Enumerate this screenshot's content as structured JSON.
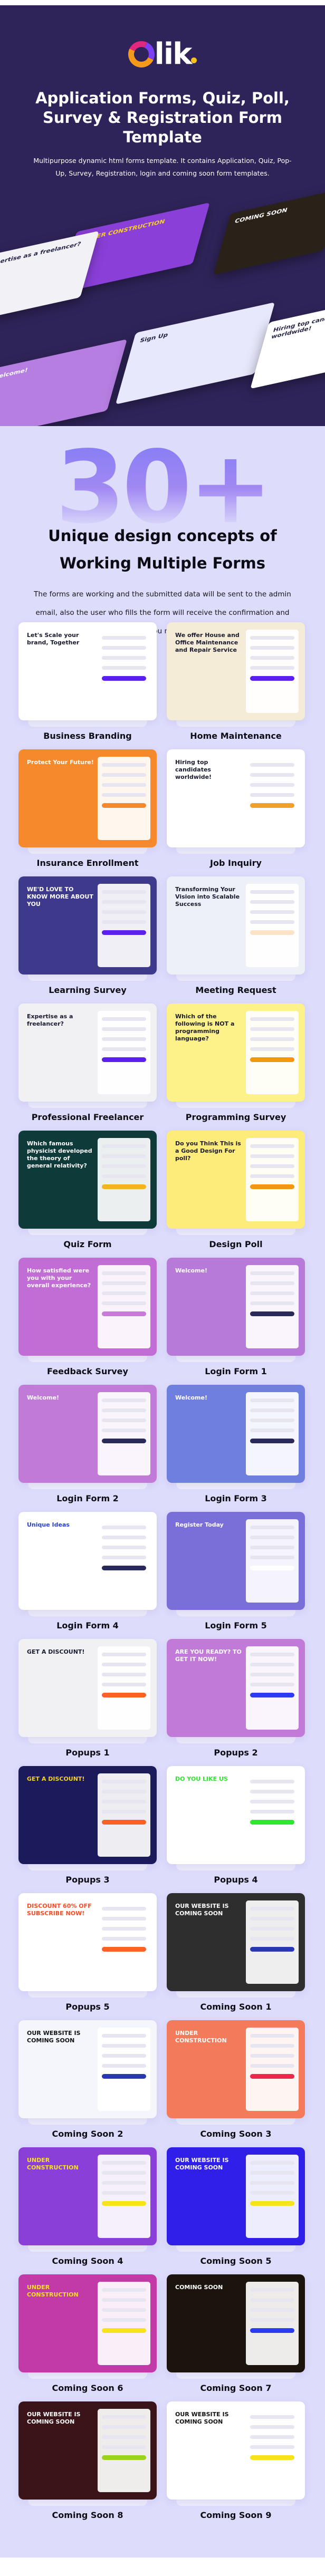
{
  "hero": {
    "logo_text": "lik",
    "title": "Application Forms, Quiz, Poll, Survey & Registration Form Template",
    "subtitle": "Multipurpose dynamic html forms template. It contains Application, Quiz, Pop-Up, Survey, Registration, login and coming soon form templates.",
    "collage": [
      {
        "text": "UNDER CONSTRUCTION",
        "bg": "#8a3fd8",
        "fg": "#f7d21c"
      },
      {
        "text": "COMING SOON",
        "bg": "#2a2118",
        "fg": "#ffffff"
      },
      {
        "text": "Welcome!",
        "bg": "#b57ee0",
        "fg": "#ffffff"
      },
      {
        "text": "Sign Up",
        "bg": "#e7e8fb",
        "fg": "#222244"
      },
      {
        "text": "Hiring top candidates worldwide!",
        "bg": "#ffffff",
        "fg": "#222244"
      },
      {
        "text": "Expertise as a freelancer?",
        "bg": "#f1f1f6",
        "fg": "#222244"
      }
    ]
  },
  "intro": {
    "count": "30+",
    "title": "Unique design concepts of Working Multiple Forms",
    "text": "The forms are working and the submitted data will be sent to the admin email, also the user who fills the form will receive the confirmation and thank you message."
  },
  "templates": [
    {
      "label": "Business Branding",
      "headline": "Let's Scale your brand, Together",
      "bg": "#ffffff",
      "fg": "#1a1a2e",
      "accent": "#5b1ff0"
    },
    {
      "label": "Home Maintenance",
      "headline": "We offer House and Office Maintenance and Repair Service",
      "bg": "#f4ecd6",
      "fg": "#1a1a2e",
      "accent": "#5b1ff0"
    },
    {
      "label": "Insurance Enrollment",
      "headline": "Protect Your Future!",
      "bg": "#f5892b",
      "fg": "#ffffff",
      "accent": "#f5892b"
    },
    {
      "label": "Job Inquiry",
      "headline": "Hiring top candidates worldwide!",
      "bg": "#ffffff",
      "fg": "#1a1a2e",
      "accent": "#f0a02a"
    },
    {
      "label": "Learning Survey",
      "headline": "WE'D LOVE TO KNOW MORE ABOUT YOU",
      "bg": "#3d3a8c",
      "fg": "#ffffff",
      "accent": "#5b1ff0"
    },
    {
      "label": "Meeting Request",
      "headline": "Transforming Your Vision into Scalable Success",
      "bg": "#eef0f8",
      "fg": "#1a1a2e",
      "accent": "#fbe3c8"
    },
    {
      "label": "Professional Freelancer",
      "headline": "Expertise as a freelancer?",
      "bg": "#f1f1f4",
      "fg": "#1a1a2e",
      "accent": "#5b1ff0"
    },
    {
      "label": "Programming Survey",
      "headline": "Which of the following is NOT a programming language?",
      "bg": "#fdf18a",
      "fg": "#1a1a2e",
      "accent": "#f5960f"
    },
    {
      "label": "Quiz Form",
      "headline": "Which famous physicist developed the theory of general relativity?",
      "bg": "#0f3a3a",
      "fg": "#ffffff",
      "accent": "#f5b41c"
    },
    {
      "label": "Design Poll",
      "headline": "Do you Think This is a Good Design For poll?",
      "bg": "#fdeb7a",
      "fg": "#1a1a2e",
      "accent": "#f5960f"
    },
    {
      "label": "Feedback Survey",
      "headline": "How satisfied were you with your overall experience?",
      "bg": "#c26dd6",
      "fg": "#ffffff",
      "accent": "#c87ad8"
    },
    {
      "label": "Login Form 1",
      "headline": "Welcome!",
      "bg": "#b87ad9",
      "fg": "#ffffff",
      "accent": "#2a2a5a"
    },
    {
      "label": "Login Form 2",
      "headline": "Welcome!",
      "bg": "#c27ad8",
      "fg": "#ffffff",
      "accent": "#2a2a5a"
    },
    {
      "label": "Login Form 3",
      "headline": "Welcome!",
      "bg": "#6f7fe0",
      "fg": "#ffffff",
      "accent": "#2a2a5a"
    },
    {
      "label": "Login Form 4",
      "headline": "Unique Ideas",
      "bg": "#ffffff",
      "fg": "#2840d0",
      "accent": "#2a2a5a"
    },
    {
      "label": "Login Form 5",
      "headline": "Register Today",
      "bg": "#7a6fd8",
      "fg": "#ffffff",
      "accent": "#ffffff"
    },
    {
      "label": "Popups 1",
      "headline": "GET A DISCOUNT!",
      "bg": "#f1f1f4",
      "fg": "#1a1a2e",
      "accent": "#fb6024"
    },
    {
      "label": "Popups 2",
      "headline": "ARE YOU READY? TO GET IT NOW!",
      "bg": "#c27ad8",
      "fg": "#ffffff",
      "accent": "#2b3bef"
    },
    {
      "label": "Popups 3",
      "headline": "GET A DISCOUNT!",
      "bg": "#1b1a5a",
      "fg": "#f7d21c",
      "accent": "#fb6024"
    },
    {
      "label": "Popups 4",
      "headline": "DO YOU LIKE US",
      "bg": "#ffffff",
      "fg": "#2ee82e",
      "accent": "#2ee82e"
    },
    {
      "label": "Popups 5",
      "headline": "DISCOUNT 60% OFF SUBSCRIBE NOW!",
      "bg": "#ffffff",
      "fg": "#fb4a24",
      "accent": "#fb6024"
    },
    {
      "label": "Coming Soon 1",
      "headline": "OUR WEBSITE IS COMING SOON",
      "bg": "#2e2e2e",
      "fg": "#ffffff",
      "accent": "#2838b0"
    },
    {
      "label": "Coming Soon 2",
      "headline": "OUR WEBSITE IS COMING SOON",
      "bg": "#f4f6fc",
      "fg": "#111111",
      "accent": "#2838b0"
    },
    {
      "label": "Coming Soon 3",
      "headline": "UNDER CONSTRUCTION",
      "bg": "#f37a5a",
      "fg": "#ffffff",
      "accent": "#f0264a"
    },
    {
      "label": "Coming Soon 4",
      "headline": "UNDER CONSTRUCTION",
      "bg": "#8a3fd8",
      "fg": "#f7e21c",
      "accent": "#f7e21c"
    },
    {
      "label": "Coming Soon 5",
      "headline": "OUR WEBSITE IS COMING SOON",
      "bg": "#2f1fe8",
      "fg": "#ffffff",
      "accent": "#f7e21c"
    },
    {
      "label": "Coming Soon 6",
      "headline": "UNDER CONSTRUCTION",
      "bg": "#c23aa8",
      "fg": "#f7e21c",
      "accent": "#f7e21c"
    },
    {
      "label": "Coming Soon 7",
      "headline": "COMING SOON",
      "bg": "#1a140c",
      "fg": "#ffffff",
      "accent": "#2b3bef"
    },
    {
      "label": "Coming Soon 8",
      "headline": "OUR WEBSITE IS COMING SOON",
      "bg": "#3a1418",
      "fg": "#ffffff",
      "accent": "#9ad21c"
    },
    {
      "label": "Coming Soon 9",
      "headline": "OUR WEBSITE IS COMING SOON",
      "bg": "#ffffff",
      "fg": "#111111",
      "accent": "#f7e21c"
    }
  ]
}
